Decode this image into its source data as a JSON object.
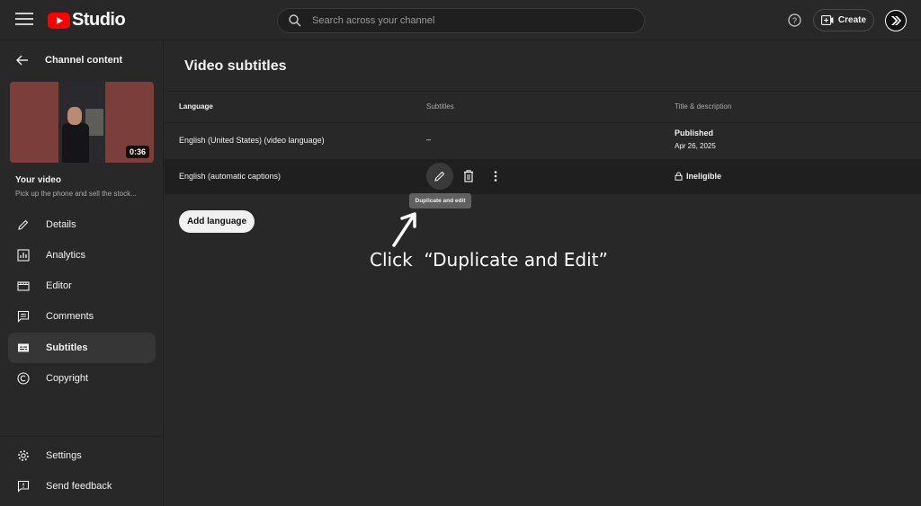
{
  "app": {
    "logo_text": "Studio"
  },
  "search": {
    "placeholder": "Search across your channel"
  },
  "header": {
    "create_label": "Create"
  },
  "sidebar": {
    "back_label": "Channel content",
    "video": {
      "duration": "0:36",
      "heading": "Your video",
      "title": "Pick up the phone and sell the stock..."
    },
    "items": [
      {
        "label": "Details",
        "icon": "pencil-icon"
      },
      {
        "label": "Analytics",
        "icon": "analytics-icon"
      },
      {
        "label": "Editor",
        "icon": "editor-icon"
      },
      {
        "label": "Comments",
        "icon": "comments-icon"
      },
      {
        "label": "Subtitles",
        "icon": "subtitles-icon",
        "active": true
      },
      {
        "label": "Copyright",
        "icon": "copyright-icon"
      }
    ],
    "bottom_items": [
      {
        "label": "Settings",
        "icon": "gear-icon"
      },
      {
        "label": "Send feedback",
        "icon": "feedback-icon"
      }
    ]
  },
  "main": {
    "title": "Video subtitles",
    "columns": [
      "Language",
      "Subtitles",
      "Title & description"
    ],
    "rows": [
      {
        "language": "English (United States) (video language)",
        "subtitles": "–",
        "title_status": "Published",
        "title_date": "Apr 26, 2025"
      },
      {
        "language": "English (automatic captions)",
        "title_status": "Ineligible"
      }
    ],
    "tooltip": "Duplicate and edit",
    "add_language_label": "Add language",
    "annotation": "Click  “Duplicate and Edit”"
  }
}
